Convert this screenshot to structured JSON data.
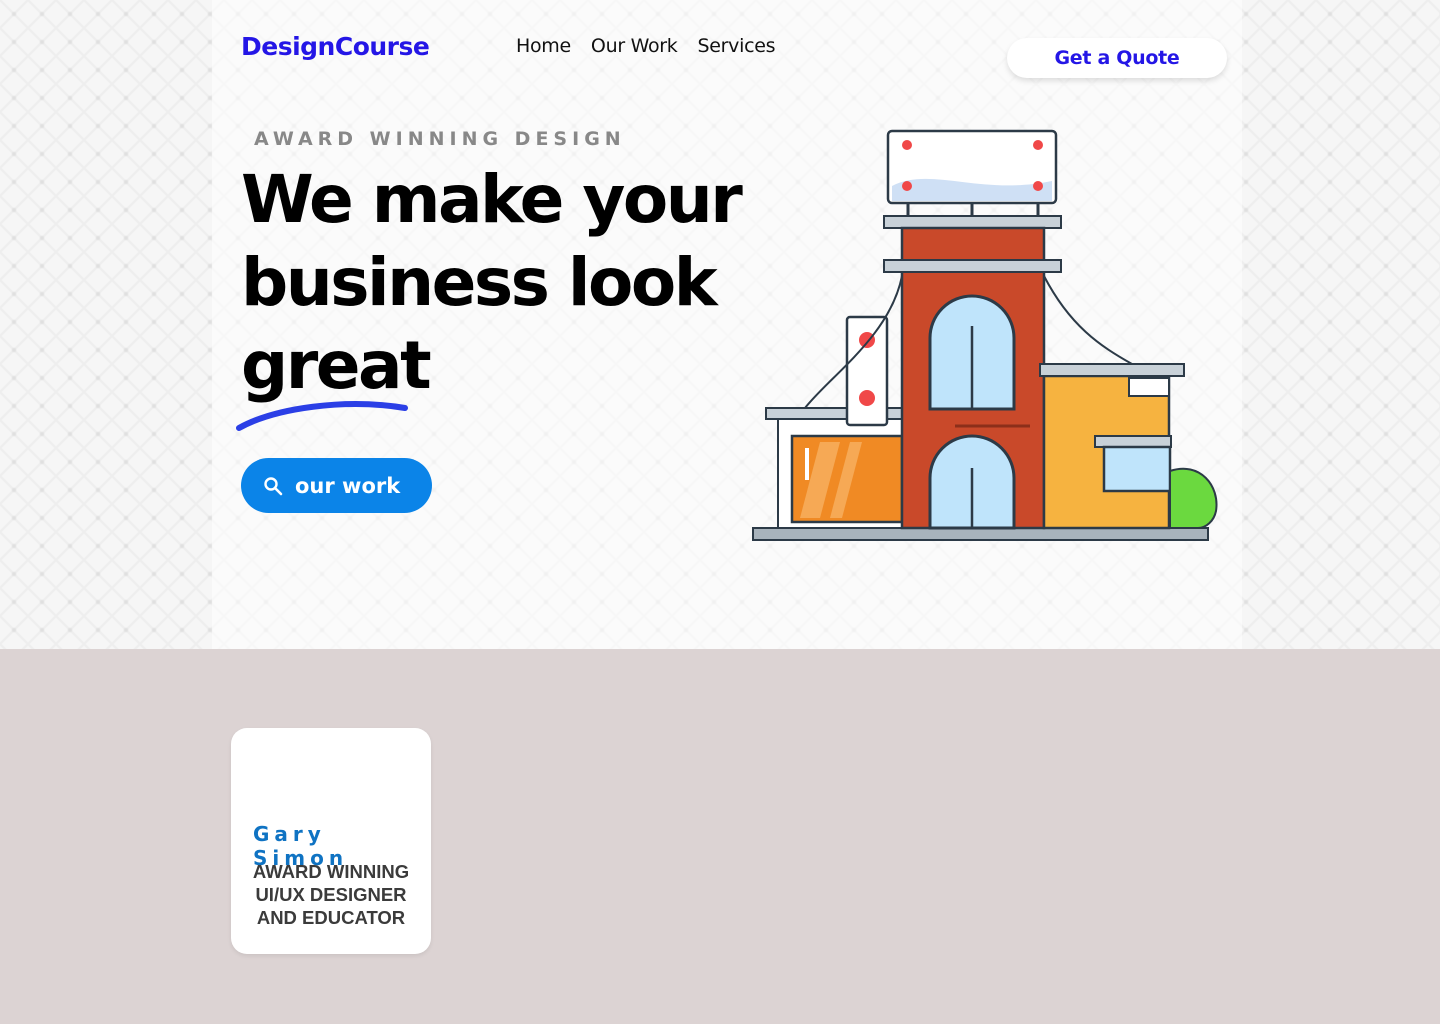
{
  "header": {
    "logo": "DesignCourse",
    "nav": [
      {
        "label": "Home"
      },
      {
        "label": "Our Work"
      },
      {
        "label": "Services"
      }
    ],
    "cta_label": "Get a Quote"
  },
  "hero": {
    "eyebrow": "AWARD WINNING DESIGN",
    "headline_lines": [
      "We make your",
      "business look",
      "great"
    ],
    "button_label": "our work",
    "button_icon": "search-icon",
    "illustration": "storefront-building-illustration"
  },
  "profile_card": {
    "name": "Gary Simon",
    "role_lines": [
      "AWARD WINNING",
      "UI/UX DESIGNER",
      "AND EDUCATOR"
    ]
  },
  "colors": {
    "brand": "#2416e6",
    "button": "#0b84e8",
    "underline": "#2b3fe6",
    "section_bg": "#dcd3d3",
    "name_color": "#0f73c3"
  }
}
